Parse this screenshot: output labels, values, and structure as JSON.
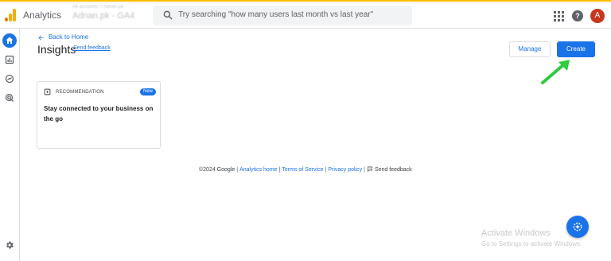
{
  "header": {
    "app_name": "Analytics",
    "account_breadcrumb": "All accounts > Adnan.pk",
    "account_property": "Adnan.pk - GA4",
    "search_placeholder": "Try searching \"how many users last month vs last year\"",
    "avatar_initial": "A",
    "help_label": "?"
  },
  "page": {
    "back_label": "Back to Home",
    "title": "Insights",
    "feedback_label": "Send feedback",
    "manage_label": "Manage",
    "create_label": "Create"
  },
  "card": {
    "kicker": "RECOMMENDATION",
    "badge": "New",
    "title": "Stay connected to your business on the go"
  },
  "footer": {
    "copyright": "©2024 Google",
    "analytics_home": "Analytics home",
    "terms": "Terms of Service",
    "privacy": "Privacy policy",
    "send_feedback": "Send feedback"
  },
  "watermark": {
    "line1": "Activate Windows",
    "line2": "Go to Settings to activate Windows."
  },
  "colors": {
    "accent": "#1a73e8",
    "logo_orange": "#f9ab00",
    "logo_dark_orange": "#e37400",
    "avatar": "#c5381f",
    "annotation_arrow": "#2ecc40"
  },
  "icons": {
    "logo": "analytics-logo-icon",
    "search": "search-icon",
    "apps": "apps-grid-icon",
    "help": "help-icon",
    "nav": [
      "home-icon",
      "reports-icon",
      "explore-icon",
      "advertising-icon"
    ],
    "settings": "gear-icon",
    "fab": "insights-sparkle-icon"
  }
}
